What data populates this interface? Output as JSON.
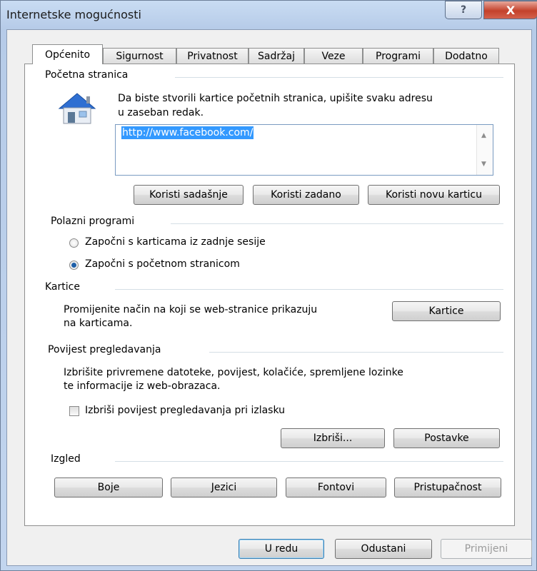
{
  "window": {
    "title": "Internetske mogućnosti",
    "help_label": "?",
    "close_label": "X"
  },
  "tabs": [
    {
      "label": "Općenito"
    },
    {
      "label": "Sigurnost"
    },
    {
      "label": "Privatnost"
    },
    {
      "label": "Sadržaj"
    },
    {
      "label": "Veze"
    },
    {
      "label": "Programi"
    },
    {
      "label": "Dodatno"
    }
  ],
  "home": {
    "heading": "Početna stranica",
    "desc_line1": "Da biste stvorili kartice početnih stranica, upišite svaku adresu",
    "desc_line2": "u zaseban redak.",
    "url": "http://www.facebook.com/",
    "btn_current": "Koristi sadašnje",
    "btn_default": "Koristi zadano",
    "btn_newtab": "Koristi novu karticu"
  },
  "startup": {
    "heading": "Polazni programi",
    "option1": "Započni s karticama iz zadnje sesije",
    "option2": "Započni s početnom stranicom",
    "selected": "option2"
  },
  "tabs_section": {
    "heading": "Kartice",
    "desc_line1": "Promijenite način na koji se web-stranice prikazuju",
    "desc_line2": "na karticama.",
    "button": "Kartice"
  },
  "history": {
    "heading": "Povijest pregledavanja",
    "desc_line1": "Izbrišite privremene datoteke, povijest, kolačiće, spremljene lozinke",
    "desc_line2": "te informacije iz web-obrazaca.",
    "checkbox_label": "Izbriši povijest pregledavanja pri izlasku",
    "checked": false,
    "btn_delete": "Izbriši...",
    "btn_settings": "Postavke"
  },
  "appearance": {
    "heading": "Izgled",
    "btn_colors": "Boje",
    "btn_languages": "Jezici",
    "btn_fonts": "Fontovi",
    "btn_accessibility": "Pristupačnost"
  },
  "footer": {
    "ok": "U redu",
    "cancel": "Odustani",
    "apply": "Primijeni"
  }
}
